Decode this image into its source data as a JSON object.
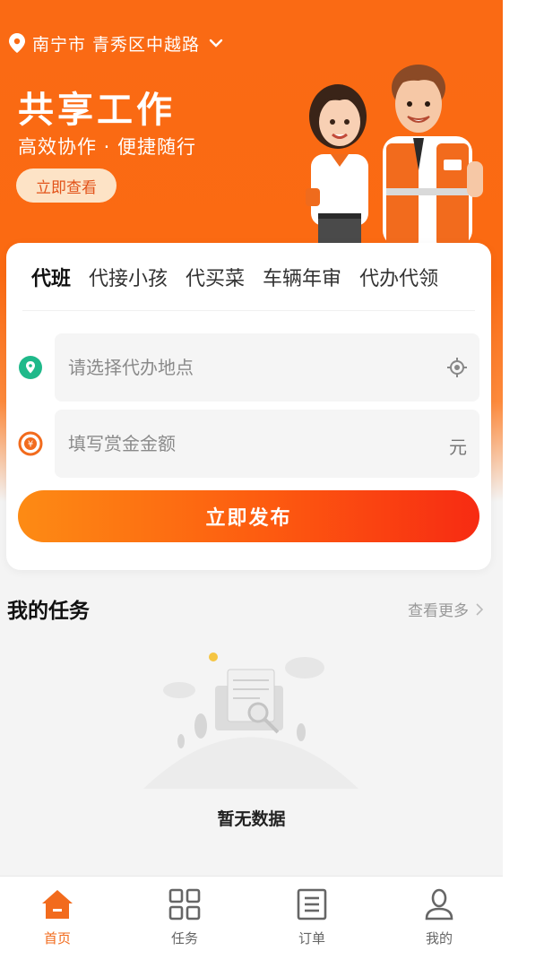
{
  "location": {
    "text": "南宁市 青秀区中越路"
  },
  "hero": {
    "title": "共享工作",
    "subtitle": "高效协作 · 便捷随行",
    "button": "立即查看"
  },
  "card": {
    "tabs": [
      "代班",
      "代接小孩",
      "代买菜",
      "车辆年审",
      "代办代领"
    ],
    "active_tab": "代班",
    "address_placeholder": "请选择代办地点",
    "reward_placeholder": "填写赏金金额",
    "reward_unit": "元",
    "reward_icon_symbol": "¥",
    "publish_button": "立即发布"
  },
  "tasks": {
    "title": "我的任务",
    "more": "查看更多",
    "empty": "暂无数据"
  },
  "tabbar": {
    "items": [
      {
        "label": "首页",
        "icon": "home-icon",
        "active": true
      },
      {
        "label": "任务",
        "icon": "grid-icon",
        "active": false
      },
      {
        "label": "订单",
        "icon": "list-icon",
        "active": false
      },
      {
        "label": "我的",
        "icon": "user-icon",
        "active": false
      }
    ]
  },
  "colors": {
    "primary": "#fa6a14",
    "accent_green": "#1fb98a",
    "tab_active": "#f26b1d"
  }
}
